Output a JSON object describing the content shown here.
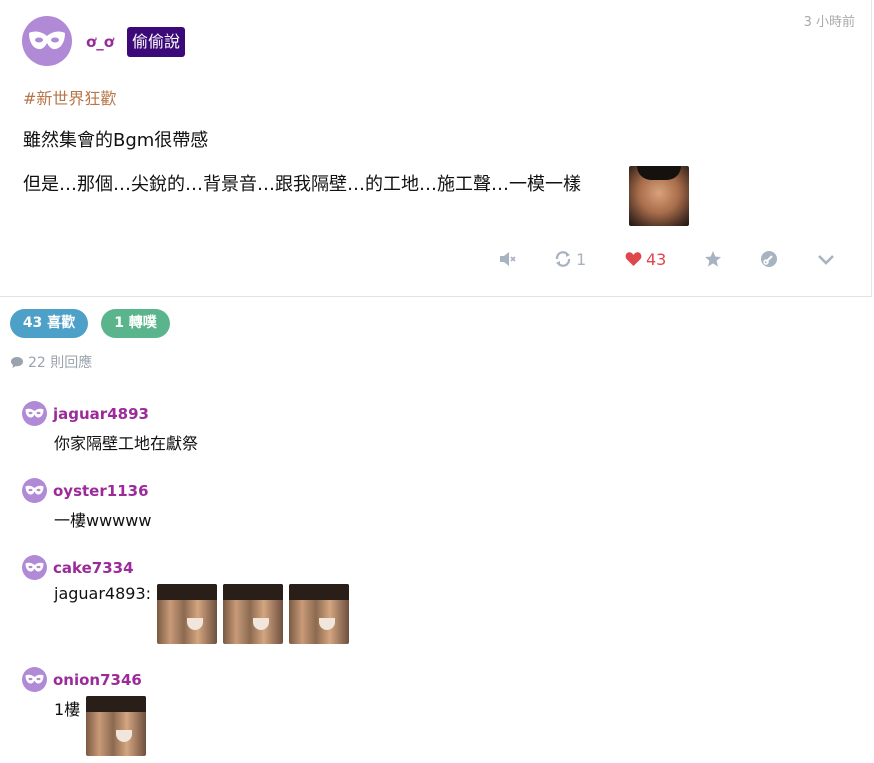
{
  "post": {
    "author": "ơ_ơ",
    "badge": "偷偷說",
    "timestamp": "3 小時前",
    "hashtag": "#新世界狂歡",
    "line1": "雖然集會的Bgm很帶感",
    "line2": "但是…那個…尖銳的…背景音…跟我隔壁…的工地…施工聲…一模一樣",
    "actions": {
      "repost_count": "1",
      "like_count": "43"
    }
  },
  "stats": {
    "likes_pill": "43 喜歡",
    "reposts_pill": "1 轉噗",
    "reply_count": "22 則回應"
  },
  "comments": [
    {
      "name": "jaguar4893",
      "text": "你家隔壁工地在獻祭"
    },
    {
      "name": "oyster1136",
      "text": "一樓wwwww"
    },
    {
      "name": "cake7334",
      "text": "jaguar4893:"
    },
    {
      "name": "onion7346",
      "text": "1樓"
    }
  ],
  "colors": {
    "author": "#9b2b9b",
    "badge_bg": "#3c0a78",
    "hashtag": "#b8754a",
    "likes_pill": "#4da0c8",
    "reposts_pill": "#5bb58c",
    "heart": "#e0474c",
    "avatar": "#b08ad6"
  }
}
